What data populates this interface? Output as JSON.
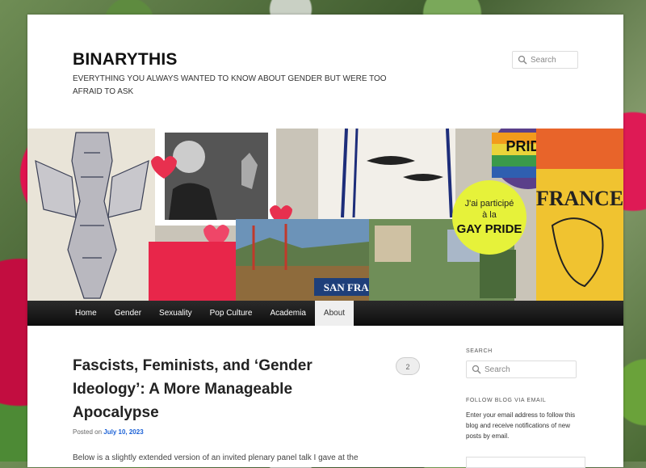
{
  "site": {
    "title": "BINARYTHIS",
    "tagline": "EVERYTHING YOU ALWAYS WANTED TO KNOW ABOUT GENDER BUT WERE TOO AFRAID TO ASK"
  },
  "header_search": {
    "placeholder": "Search",
    "icon": "search-icon"
  },
  "banner": {
    "pride_label": "PRIDE",
    "badge_line1": "J'ai participé",
    "badge_line2": "à la",
    "badge_line3": "GAY PRIDE",
    "city": "SAN FRANCISCO",
    "france_label": "FRANCE"
  },
  "nav": {
    "items": [
      {
        "label": "Home"
      },
      {
        "label": "Gender"
      },
      {
        "label": "Sexuality"
      },
      {
        "label": "Pop Culture"
      },
      {
        "label": "Academia"
      },
      {
        "label": "About"
      }
    ],
    "active_index": 5
  },
  "post": {
    "title": "Fascists, Feminists, and ‘Gender Ideology’: A More Manageable Apocalypse",
    "comment_count": "2",
    "posted_prefix": "Posted on",
    "date": "July 10, 2023",
    "excerpt": "Below is a slightly extended version of an invited plenary panel talk I gave at the"
  },
  "sidebar": {
    "search_heading": "SEARCH",
    "search_placeholder": "Search",
    "follow_heading": "FOLLOW BLOG VIA EMAIL",
    "follow_text": "Enter your email address to follow this blog and receive notifications of new posts by email."
  },
  "colors": {
    "link": "#1b61d6",
    "nav_bg": "#1a1a1a",
    "accent_pink": "#e0134f"
  }
}
